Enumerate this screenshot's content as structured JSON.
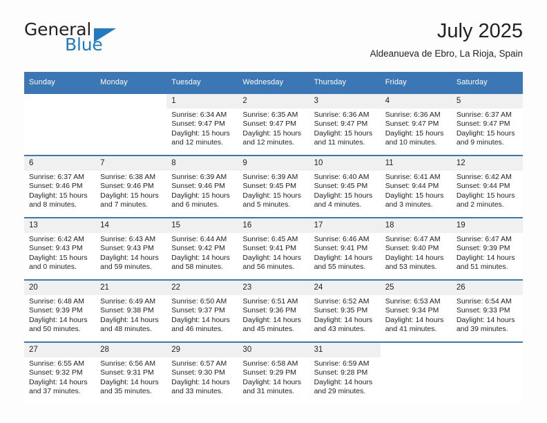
{
  "logo": {
    "word1": "General",
    "word2": "Blue",
    "accent_color": "#1e7bc4"
  },
  "header": {
    "title": "July 2025",
    "subtitle": "Aldeanueva de Ebro, La Rioja, Spain"
  },
  "calendar": {
    "header_color": "#3b77b5",
    "weekday_headers": [
      "Sunday",
      "Monday",
      "Tuesday",
      "Wednesday",
      "Thursday",
      "Friday",
      "Saturday"
    ],
    "weeks": [
      [
        {
          "day": "",
          "sunrise": "",
          "sunset": "",
          "daylight_line1": "",
          "daylight_line2": ""
        },
        {
          "day": "",
          "sunrise": "",
          "sunset": "",
          "daylight_line1": "",
          "daylight_line2": ""
        },
        {
          "day": "1",
          "sunrise": "Sunrise: 6:34 AM",
          "sunset": "Sunset: 9:47 PM",
          "daylight_line1": "Daylight: 15 hours",
          "daylight_line2": "and 12 minutes."
        },
        {
          "day": "2",
          "sunrise": "Sunrise: 6:35 AM",
          "sunset": "Sunset: 9:47 PM",
          "daylight_line1": "Daylight: 15 hours",
          "daylight_line2": "and 12 minutes."
        },
        {
          "day": "3",
          "sunrise": "Sunrise: 6:36 AM",
          "sunset": "Sunset: 9:47 PM",
          "daylight_line1": "Daylight: 15 hours",
          "daylight_line2": "and 11 minutes."
        },
        {
          "day": "4",
          "sunrise": "Sunrise: 6:36 AM",
          "sunset": "Sunset: 9:47 PM",
          "daylight_line1": "Daylight: 15 hours",
          "daylight_line2": "and 10 minutes."
        },
        {
          "day": "5",
          "sunrise": "Sunrise: 6:37 AM",
          "sunset": "Sunset: 9:47 PM",
          "daylight_line1": "Daylight: 15 hours",
          "daylight_line2": "and 9 minutes."
        }
      ],
      [
        {
          "day": "6",
          "sunrise": "Sunrise: 6:37 AM",
          "sunset": "Sunset: 9:46 PM",
          "daylight_line1": "Daylight: 15 hours",
          "daylight_line2": "and 8 minutes."
        },
        {
          "day": "7",
          "sunrise": "Sunrise: 6:38 AM",
          "sunset": "Sunset: 9:46 PM",
          "daylight_line1": "Daylight: 15 hours",
          "daylight_line2": "and 7 minutes."
        },
        {
          "day": "8",
          "sunrise": "Sunrise: 6:39 AM",
          "sunset": "Sunset: 9:46 PM",
          "daylight_line1": "Daylight: 15 hours",
          "daylight_line2": "and 6 minutes."
        },
        {
          "day": "9",
          "sunrise": "Sunrise: 6:39 AM",
          "sunset": "Sunset: 9:45 PM",
          "daylight_line1": "Daylight: 15 hours",
          "daylight_line2": "and 5 minutes."
        },
        {
          "day": "10",
          "sunrise": "Sunrise: 6:40 AM",
          "sunset": "Sunset: 9:45 PM",
          "daylight_line1": "Daylight: 15 hours",
          "daylight_line2": "and 4 minutes."
        },
        {
          "day": "11",
          "sunrise": "Sunrise: 6:41 AM",
          "sunset": "Sunset: 9:44 PM",
          "daylight_line1": "Daylight: 15 hours",
          "daylight_line2": "and 3 minutes."
        },
        {
          "day": "12",
          "sunrise": "Sunrise: 6:42 AM",
          "sunset": "Sunset: 9:44 PM",
          "daylight_line1": "Daylight: 15 hours",
          "daylight_line2": "and 2 minutes."
        }
      ],
      [
        {
          "day": "13",
          "sunrise": "Sunrise: 6:42 AM",
          "sunset": "Sunset: 9:43 PM",
          "daylight_line1": "Daylight: 15 hours",
          "daylight_line2": "and 0 minutes."
        },
        {
          "day": "14",
          "sunrise": "Sunrise: 6:43 AM",
          "sunset": "Sunset: 9:43 PM",
          "daylight_line1": "Daylight: 14 hours",
          "daylight_line2": "and 59 minutes."
        },
        {
          "day": "15",
          "sunrise": "Sunrise: 6:44 AM",
          "sunset": "Sunset: 9:42 PM",
          "daylight_line1": "Daylight: 14 hours",
          "daylight_line2": "and 58 minutes."
        },
        {
          "day": "16",
          "sunrise": "Sunrise: 6:45 AM",
          "sunset": "Sunset: 9:41 PM",
          "daylight_line1": "Daylight: 14 hours",
          "daylight_line2": "and 56 minutes."
        },
        {
          "day": "17",
          "sunrise": "Sunrise: 6:46 AM",
          "sunset": "Sunset: 9:41 PM",
          "daylight_line1": "Daylight: 14 hours",
          "daylight_line2": "and 55 minutes."
        },
        {
          "day": "18",
          "sunrise": "Sunrise: 6:47 AM",
          "sunset": "Sunset: 9:40 PM",
          "daylight_line1": "Daylight: 14 hours",
          "daylight_line2": "and 53 minutes."
        },
        {
          "day": "19",
          "sunrise": "Sunrise: 6:47 AM",
          "sunset": "Sunset: 9:39 PM",
          "daylight_line1": "Daylight: 14 hours",
          "daylight_line2": "and 51 minutes."
        }
      ],
      [
        {
          "day": "20",
          "sunrise": "Sunrise: 6:48 AM",
          "sunset": "Sunset: 9:39 PM",
          "daylight_line1": "Daylight: 14 hours",
          "daylight_line2": "and 50 minutes."
        },
        {
          "day": "21",
          "sunrise": "Sunrise: 6:49 AM",
          "sunset": "Sunset: 9:38 PM",
          "daylight_line1": "Daylight: 14 hours",
          "daylight_line2": "and 48 minutes."
        },
        {
          "day": "22",
          "sunrise": "Sunrise: 6:50 AM",
          "sunset": "Sunset: 9:37 PM",
          "daylight_line1": "Daylight: 14 hours",
          "daylight_line2": "and 46 minutes."
        },
        {
          "day": "23",
          "sunrise": "Sunrise: 6:51 AM",
          "sunset": "Sunset: 9:36 PM",
          "daylight_line1": "Daylight: 14 hours",
          "daylight_line2": "and 45 minutes."
        },
        {
          "day": "24",
          "sunrise": "Sunrise: 6:52 AM",
          "sunset": "Sunset: 9:35 PM",
          "daylight_line1": "Daylight: 14 hours",
          "daylight_line2": "and 43 minutes."
        },
        {
          "day": "25",
          "sunrise": "Sunrise: 6:53 AM",
          "sunset": "Sunset: 9:34 PM",
          "daylight_line1": "Daylight: 14 hours",
          "daylight_line2": "and 41 minutes."
        },
        {
          "day": "26",
          "sunrise": "Sunrise: 6:54 AM",
          "sunset": "Sunset: 9:33 PM",
          "daylight_line1": "Daylight: 14 hours",
          "daylight_line2": "and 39 minutes."
        }
      ],
      [
        {
          "day": "27",
          "sunrise": "Sunrise: 6:55 AM",
          "sunset": "Sunset: 9:32 PM",
          "daylight_line1": "Daylight: 14 hours",
          "daylight_line2": "and 37 minutes."
        },
        {
          "day": "28",
          "sunrise": "Sunrise: 6:56 AM",
          "sunset": "Sunset: 9:31 PM",
          "daylight_line1": "Daylight: 14 hours",
          "daylight_line2": "and 35 minutes."
        },
        {
          "day": "29",
          "sunrise": "Sunrise: 6:57 AM",
          "sunset": "Sunset: 9:30 PM",
          "daylight_line1": "Daylight: 14 hours",
          "daylight_line2": "and 33 minutes."
        },
        {
          "day": "30",
          "sunrise": "Sunrise: 6:58 AM",
          "sunset": "Sunset: 9:29 PM",
          "daylight_line1": "Daylight: 14 hours",
          "daylight_line2": "and 31 minutes."
        },
        {
          "day": "31",
          "sunrise": "Sunrise: 6:59 AM",
          "sunset": "Sunset: 9:28 PM",
          "daylight_line1": "Daylight: 14 hours",
          "daylight_line2": "and 29 minutes."
        },
        {
          "day": "",
          "sunrise": "",
          "sunset": "",
          "daylight_line1": "",
          "daylight_line2": ""
        },
        {
          "day": "",
          "sunrise": "",
          "sunset": "",
          "daylight_line1": "",
          "daylight_line2": ""
        }
      ]
    ]
  }
}
